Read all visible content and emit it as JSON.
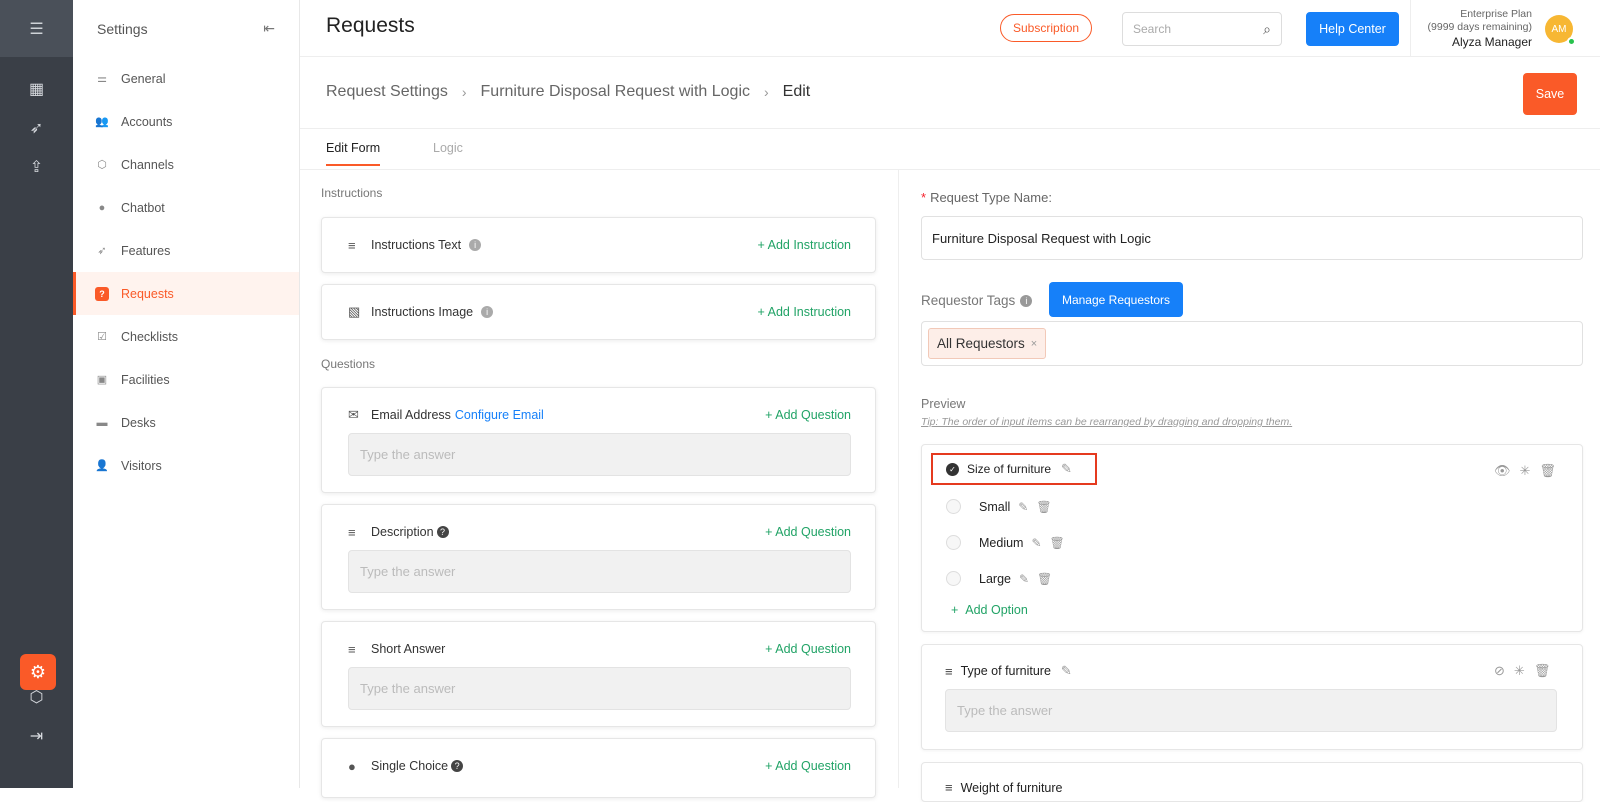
{
  "sidebar": {
    "title": "Settings",
    "items": [
      {
        "label": "General",
        "icon": "sliders-icon"
      },
      {
        "label": "Accounts",
        "icon": "users-icon"
      },
      {
        "label": "Channels",
        "icon": "cube-icon"
      },
      {
        "label": "Chatbot",
        "icon": "chat-icon"
      },
      {
        "label": "Features",
        "icon": "rocket-icon"
      },
      {
        "label": "Requests",
        "icon": "question-icon",
        "active": true
      },
      {
        "label": "Checklists",
        "icon": "checklist-icon"
      },
      {
        "label": "Facilities",
        "icon": "calendar-icon"
      },
      {
        "label": "Desks",
        "icon": "desk-icon"
      },
      {
        "label": "Visitors",
        "icon": "visitor-icon"
      }
    ]
  },
  "header": {
    "title": "Requests",
    "subscription": "Subscription",
    "search_placeholder": "Search",
    "help": "Help Center",
    "plan": "Enterprise Plan",
    "plan_remaining": "(9999 days remaining)",
    "user": "Alyza Manager",
    "avatar": "AM"
  },
  "breadcrumb": {
    "root": "Request Settings",
    "parent": "Furniture Disposal Request with Logic",
    "current": "Edit"
  },
  "save": "Save",
  "tabs": {
    "edit": "Edit Form",
    "logic": "Logic"
  },
  "left": {
    "instructions_label": "Instructions",
    "instruction_text": "Instructions Text",
    "instruction_image": "Instructions Image",
    "add_instruction": "+ Add Instruction",
    "questions_label": "Questions",
    "email": "Email Address",
    "configure_email": "Configure Email",
    "description": "Description",
    "short_answer": "Short Answer",
    "single_choice": "Single Choice",
    "add_question": "+ Add Question",
    "answer_placeholder": "Type the answer"
  },
  "right": {
    "type_name_label": "Request Type Name",
    "type_name_value": "Furniture Disposal Request with Logic",
    "tags_label": "Requestor Tags",
    "manage": "Manage Requestors",
    "tag": "All Requestors",
    "preview": "Preview",
    "tip": "Tip: The order of input items can be rearranged by dragging and dropping them.",
    "q1": "Size of furniture",
    "options": [
      "Small",
      "Medium",
      "Large"
    ],
    "add_option": "Add Option",
    "q2": "Type of furniture",
    "answer_placeholder": "Type the answer",
    "q3": "Weight of furniture"
  }
}
